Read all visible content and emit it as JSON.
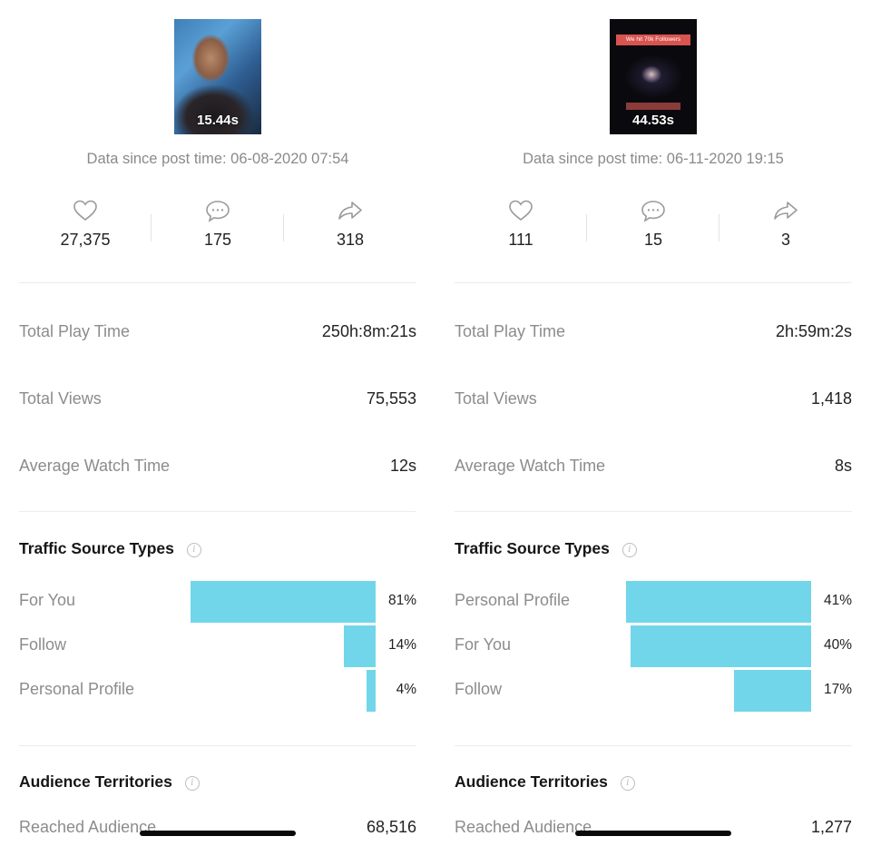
{
  "panels": [
    {
      "video": {
        "thumbnail": "painted-portrait-thumbnail",
        "duration": "15.44s"
      },
      "data_since": "Data since post time: 06-08-2020 07:54",
      "engagement": {
        "likes": {
          "icon": "heart-icon",
          "value": "27,375"
        },
        "comments": {
          "icon": "comment-icon",
          "value": "175"
        },
        "shares": {
          "icon": "share-icon",
          "value": "318"
        }
      },
      "metrics": [
        {
          "label": "Total Play Time",
          "value": "250h:8m:21s"
        },
        {
          "label": "Total Views",
          "value": "75,553"
        },
        {
          "label": "Average Watch Time",
          "value": "12s"
        }
      ],
      "traffic": {
        "title": "Traffic Source Types",
        "info_icon": "info-icon",
        "sources": [
          {
            "label": "For You",
            "percent": 81,
            "display": "81%"
          },
          {
            "label": "Follow",
            "percent": 14,
            "display": "14%"
          },
          {
            "label": "Personal Profile",
            "percent": 4,
            "display": "4%"
          }
        ]
      },
      "audience": {
        "title": "Audience Territories",
        "info_icon": "info-icon",
        "reached_label": "Reached Audience",
        "reached_value": "68,516"
      }
    },
    {
      "video": {
        "thumbnail": "space-followers-thumbnail",
        "banner_text": "We hit 70k Followers",
        "duration": "44.53s"
      },
      "data_since": "Data since post time: 06-11-2020 19:15",
      "engagement": {
        "likes": {
          "icon": "heart-icon",
          "value": "111"
        },
        "comments": {
          "icon": "comment-icon",
          "value": "15"
        },
        "shares": {
          "icon": "share-icon",
          "value": "3"
        }
      },
      "metrics": [
        {
          "label": "Total Play Time",
          "value": "2h:59m:2s"
        },
        {
          "label": "Total Views",
          "value": "1,418"
        },
        {
          "label": "Average Watch Time",
          "value": "8s"
        }
      ],
      "traffic": {
        "title": "Traffic Source Types",
        "info_icon": "info-icon",
        "sources": [
          {
            "label": "Personal Profile",
            "percent": 41,
            "display": "41%"
          },
          {
            "label": "For You",
            "percent": 40,
            "display": "40%"
          },
          {
            "label": "Follow",
            "percent": 17,
            "display": "17%"
          }
        ]
      },
      "audience": {
        "title": "Audience Territories",
        "info_icon": "info-icon",
        "reached_label": "Reached Audience",
        "reached_value": "1,277"
      }
    }
  ],
  "colors": {
    "bar": "#72d6ea",
    "label_gray": "#8c8c8c",
    "value_dark": "#222222"
  }
}
